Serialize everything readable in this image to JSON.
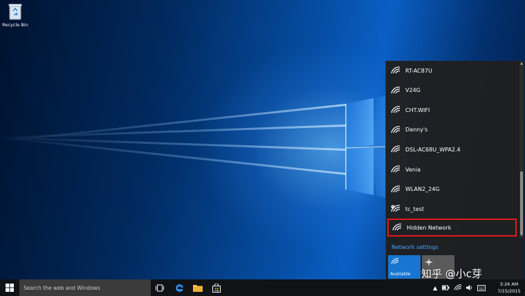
{
  "desktop": {
    "recycle_bin_label": "Recycle Bin"
  },
  "network_flyout": {
    "networks": [
      {
        "name": "RT-AC87U",
        "secured": true
      },
      {
        "name": "V24G",
        "secured": true
      },
      {
        "name": "CHT.WIFI",
        "secured": true
      },
      {
        "name": "Danny's",
        "secured": true
      },
      {
        "name": "DSL-AC68U_WPA2.4",
        "secured": true
      },
      {
        "name": "Venia",
        "secured": true
      },
      {
        "name": "WLAN2_24G",
        "secured": true
      },
      {
        "name": "tc_test",
        "secured": false
      }
    ],
    "hidden_network": "Hidden Network",
    "network_settings_label": "Network settings",
    "tiles": {
      "available_label": "Available"
    },
    "colors": {
      "accent": "#1875d1",
      "link": "#4da3ff",
      "highlight": "#e01a1a"
    }
  },
  "watermark": "知乎 @小c芽",
  "taskbar": {
    "search_placeholder": "Search the web and Windows",
    "clock": {
      "time": "3:26 AM",
      "date": "7/15/2015"
    }
  }
}
